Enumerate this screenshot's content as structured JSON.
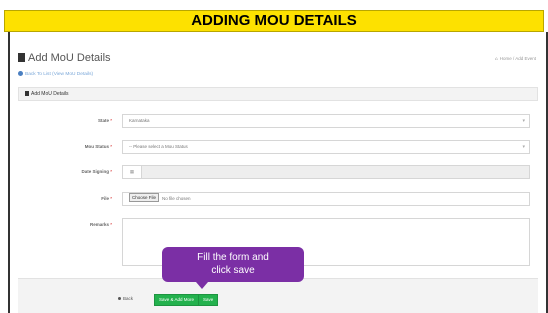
{
  "banner": {
    "title": "ADDING MOU DETAILS"
  },
  "header": {
    "page_title": "Add MoU Details",
    "back_link": "Back To List (View MoU Details)",
    "breadcrumb_home": "Home",
    "breadcrumb_current": "Add Event"
  },
  "panel": {
    "heading": "Add MoU Details"
  },
  "form": {
    "state_label": "State",
    "state_value": "Karnataka",
    "mou_status_label": "Mou Status",
    "mou_status_placeholder": "-- Please select a Mou Status",
    "date_signing_label": "Date Signing",
    "file_label": "File",
    "file_button": "Choose File",
    "file_status": "No file chosen",
    "remarks_label": "Remarks",
    "required_mark": "*"
  },
  "footer": {
    "back_label": "Back",
    "save_more_label": "Save & Add More",
    "save_label": "Save"
  },
  "tooltip": {
    "text_line1": "Fill the form and",
    "text_line2": "click save"
  },
  "colors": {
    "banner": "#fde100",
    "tooltip": "#7b2fa5",
    "save_button": "#23b14d"
  }
}
